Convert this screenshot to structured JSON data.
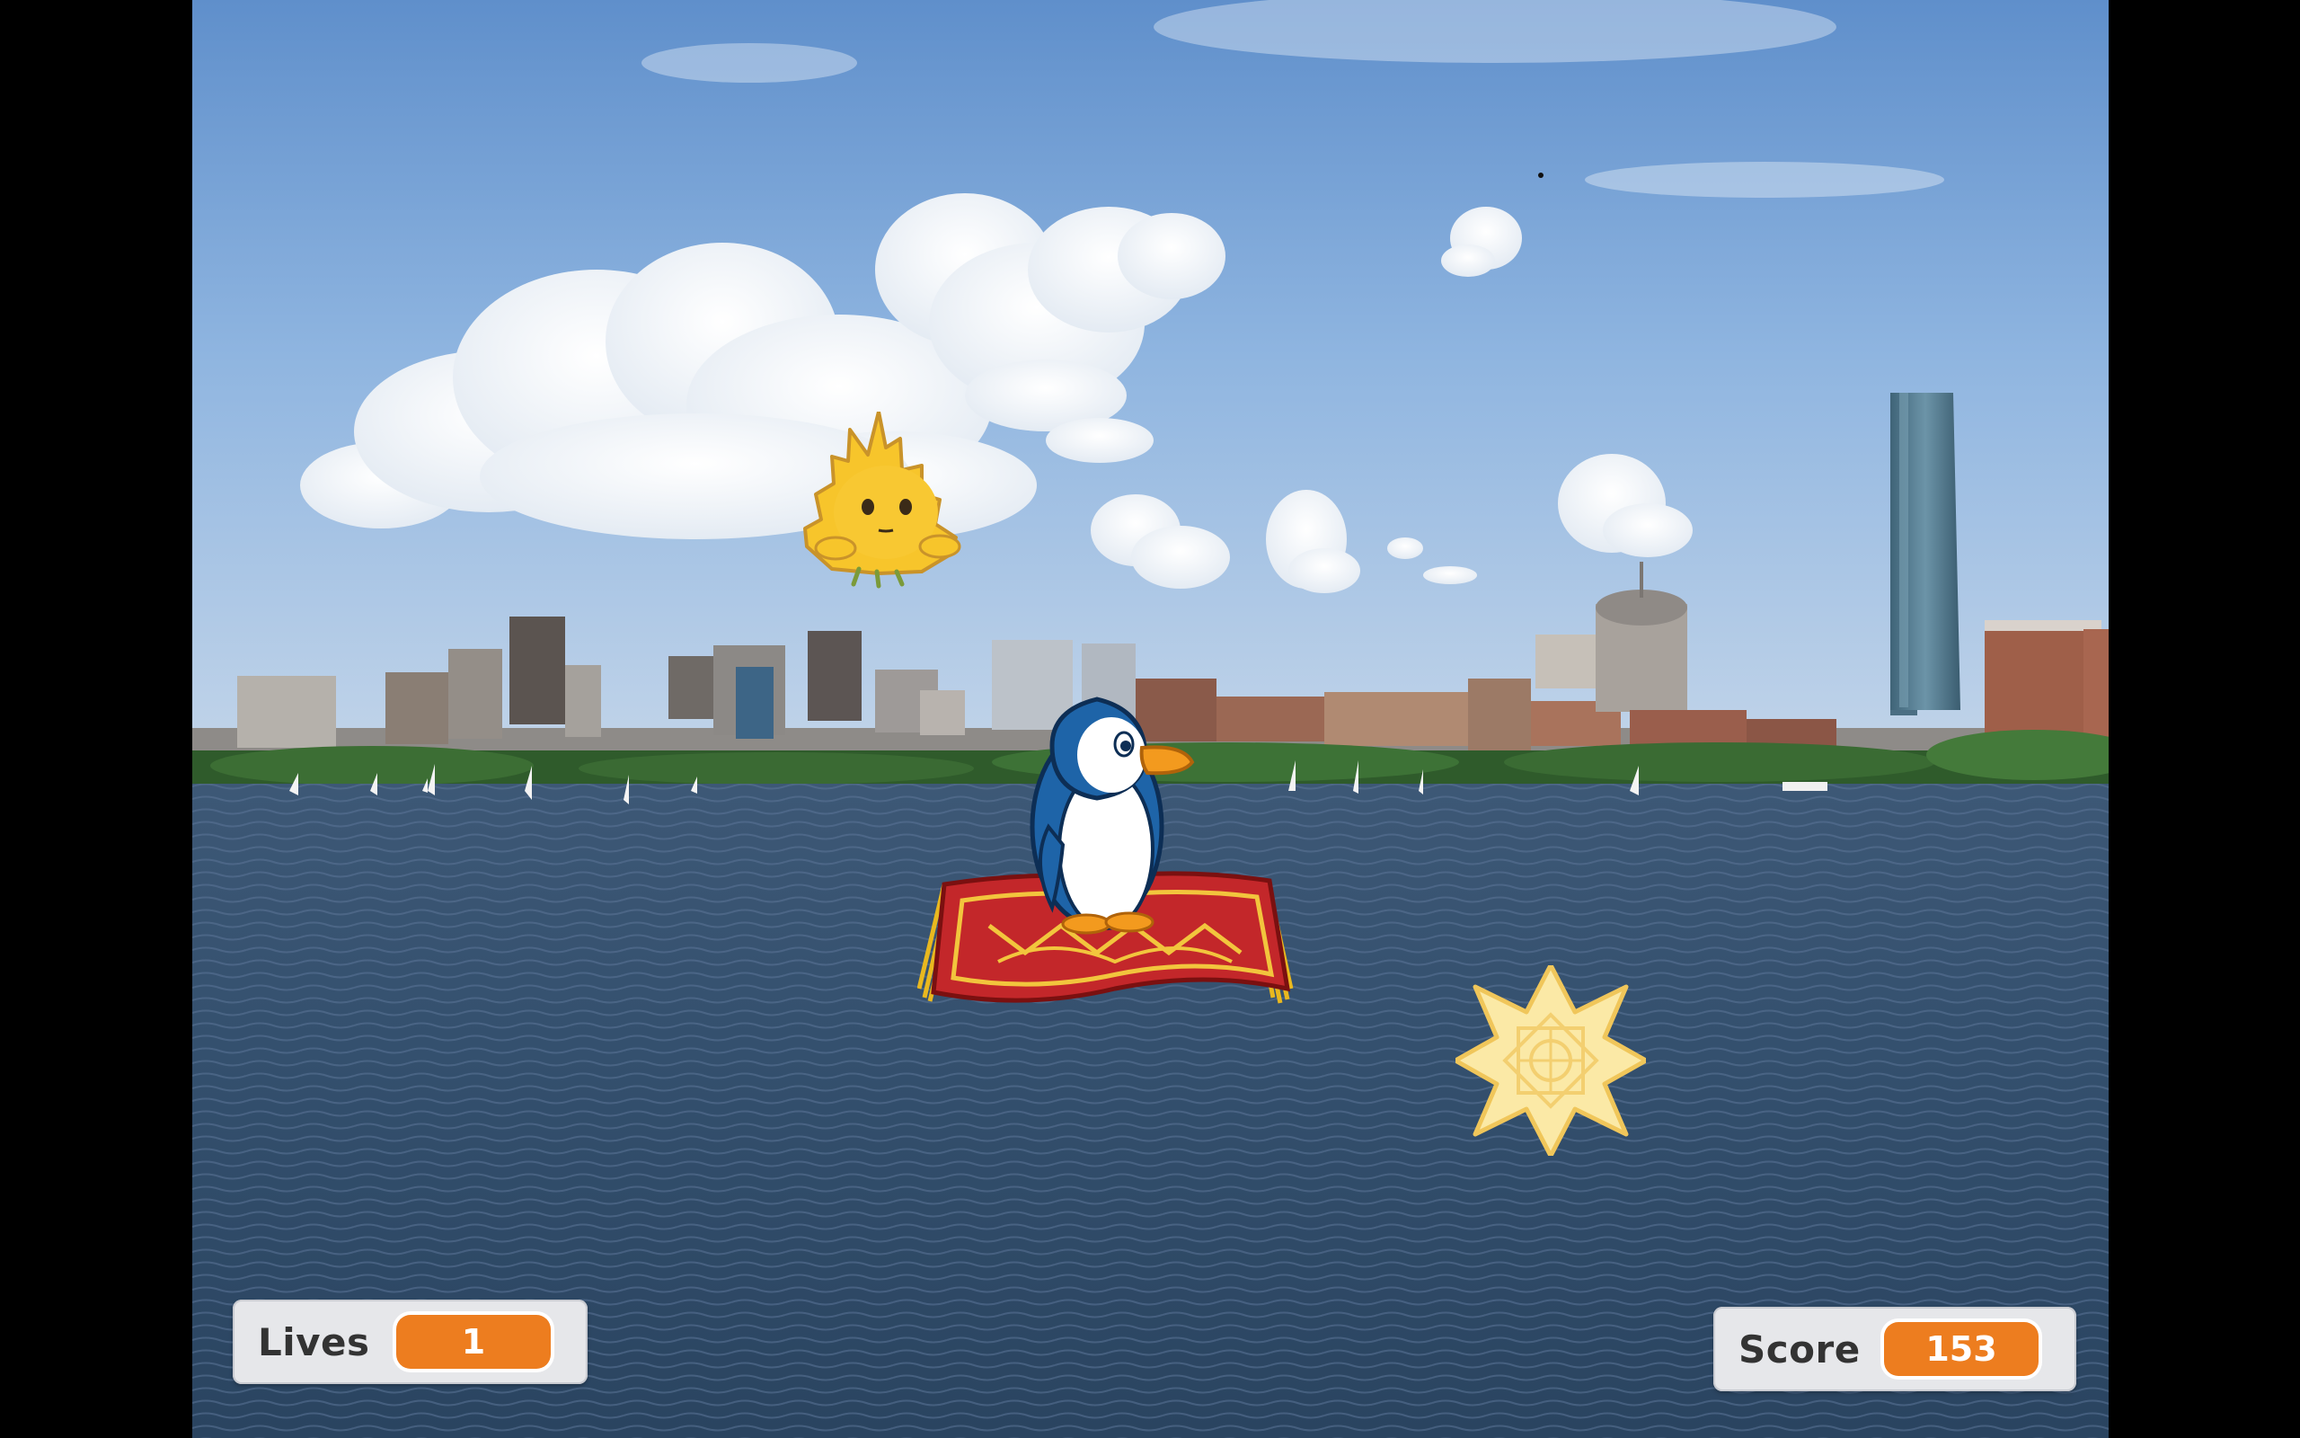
{
  "stage": {
    "background": "boston-skyline-river-backdrop"
  },
  "sprites": {
    "player": {
      "icon": "penguin-on-magic-carpet"
    },
    "enemy": {
      "icon": "spiky-yellow-creature"
    },
    "collectible": {
      "icon": "gold-star"
    }
  },
  "monitors": {
    "lives": {
      "label": "Lives",
      "value": "1"
    },
    "score": {
      "label": "Score",
      "value": "153"
    }
  },
  "colors": {
    "monitor_value": "#ed7d1f",
    "monitor_bg": "#e6e7ea",
    "sky": "#7ba7d8",
    "water": "#2f4a66"
  }
}
